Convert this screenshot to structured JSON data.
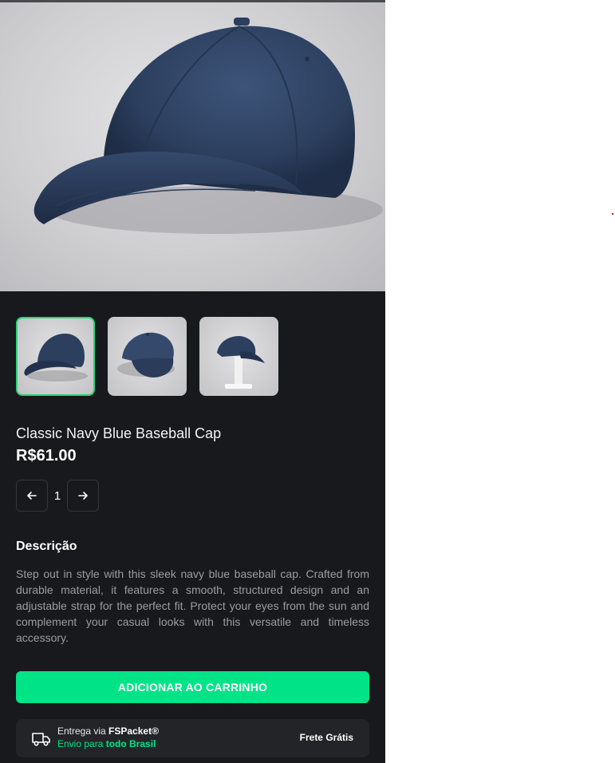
{
  "product": {
    "title": "Classic Navy Blue Baseball Cap",
    "price": "R$61.00",
    "image_alt": "navy-baseball-cap",
    "thumbnails": [
      {
        "name": "cap-side-view",
        "active": true
      },
      {
        "name": "cap-three-quarter-view",
        "active": false
      },
      {
        "name": "cap-on-stand",
        "active": false
      }
    ]
  },
  "quantity": {
    "value": "1",
    "decrease_icon": "arrow-left-icon",
    "increase_icon": "arrow-right-icon"
  },
  "description": {
    "heading": "Descrição",
    "text": "Step out in style with this sleek navy blue baseball cap. Crafted from durable material, it features a smooth, structured design and an adjustable strap for the perfect fit. Protect your eyes from the sun and complement your casual looks with this versatile and timeless accessory."
  },
  "cart": {
    "button_label": "ADICIONAR AO CARRINHO"
  },
  "shipping": {
    "icon": "truck-icon",
    "prefix": "Entrega via ",
    "carrier": "FSPacket®",
    "region_prefix": "Envio para ",
    "region": "todo Brasil",
    "free_label": "Frete Grátis"
  },
  "colors": {
    "background": "#18191c",
    "accent": "#00e487",
    "cap": "#2f4466"
  }
}
